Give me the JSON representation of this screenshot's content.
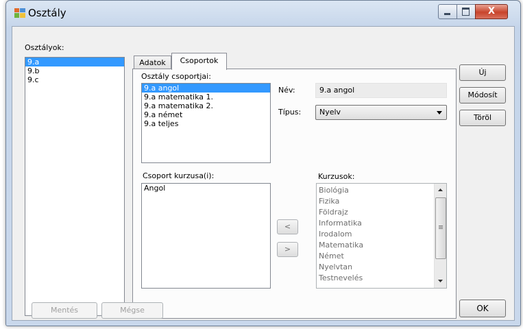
{
  "window": {
    "title": "Osztály",
    "close_glyph": "X"
  },
  "left": {
    "label": "Osztályok:",
    "items": [
      "9.a",
      "9.b",
      "9.c"
    ],
    "selected_index": 0
  },
  "tabs": [
    {
      "label": "Adatok",
      "active": false
    },
    {
      "label": "Csoportok",
      "active": true
    }
  ],
  "groups": {
    "label": "Osztály csoportjai:",
    "items": [
      "9.a angol",
      "9.a matematika 1.",
      "9.a matematika 2.",
      "9.a német",
      "9.a teljes"
    ],
    "selected_index": 0
  },
  "name": {
    "label": "Név:",
    "value": "9.a angol"
  },
  "type": {
    "label": "Típus:",
    "value": "Nyelv"
  },
  "group_courses": {
    "label": "Csoport kurzusa(i):",
    "items": [
      "Angol"
    ]
  },
  "courses": {
    "label": "Kurzusok:",
    "items": [
      "Biológia",
      "Fizika",
      "Földrajz",
      "Informatika",
      "Irodalom",
      "Matematika",
      "Német",
      "Nyelvtan",
      "Testnevelés"
    ]
  },
  "transfer": {
    "left": "<",
    "right": ">"
  },
  "actions": {
    "new": "Új",
    "modify": "Módosít",
    "delete": "Töröl"
  },
  "footer": {
    "save": "Mentés",
    "cancel": "Mégse",
    "ok": "OK"
  },
  "colors": {
    "selection": "#3399ff",
    "window_frame": "#c5d5ea",
    "close_button": "#c8432b"
  }
}
